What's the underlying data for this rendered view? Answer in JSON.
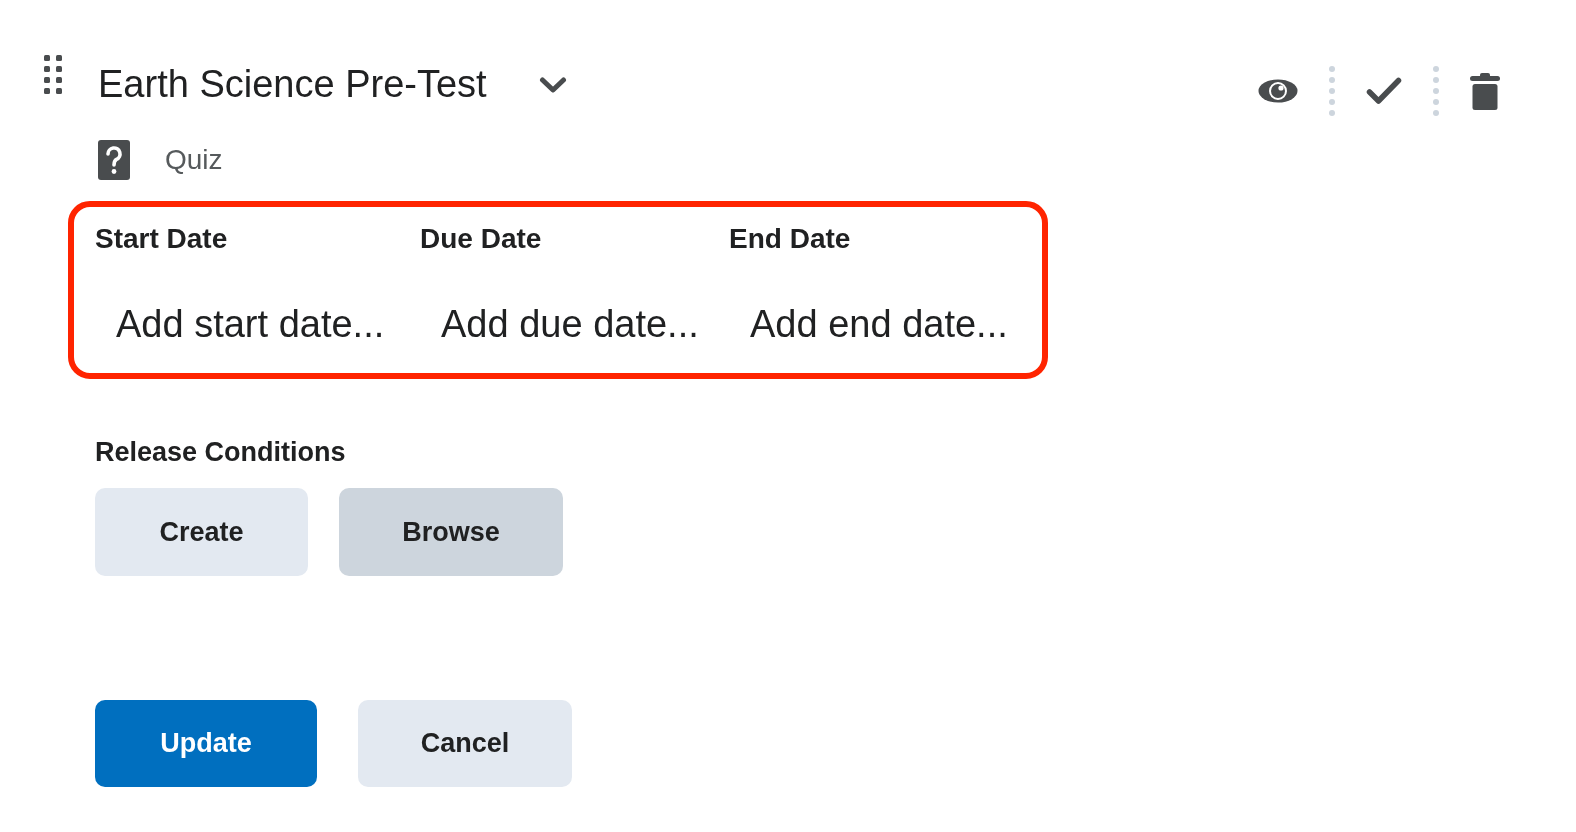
{
  "item": {
    "title": "Earth Science Pre-Test",
    "type_label": "Quiz"
  },
  "toolbar": [
    {
      "kind": "visibility"
    },
    {
      "kind": "complete"
    },
    {
      "kind": "delete"
    }
  ],
  "dates": {
    "highlighted": true,
    "fields": [
      {
        "label": "Start Date",
        "prompt": "Add start date..."
      },
      {
        "label": "Due Date",
        "prompt": "Add due date..."
      },
      {
        "label": "End Date",
        "prompt": "Add end date..."
      }
    ]
  },
  "release_conditions": {
    "heading": "Release Conditions",
    "buttons": [
      {
        "label": "Create",
        "hovered": false
      },
      {
        "label": "Browse",
        "hovered": true
      }
    ]
  },
  "actions": [
    {
      "label": "Update",
      "kind": "primary"
    },
    {
      "label": "Cancel",
      "kind": "secondary"
    }
  ]
}
